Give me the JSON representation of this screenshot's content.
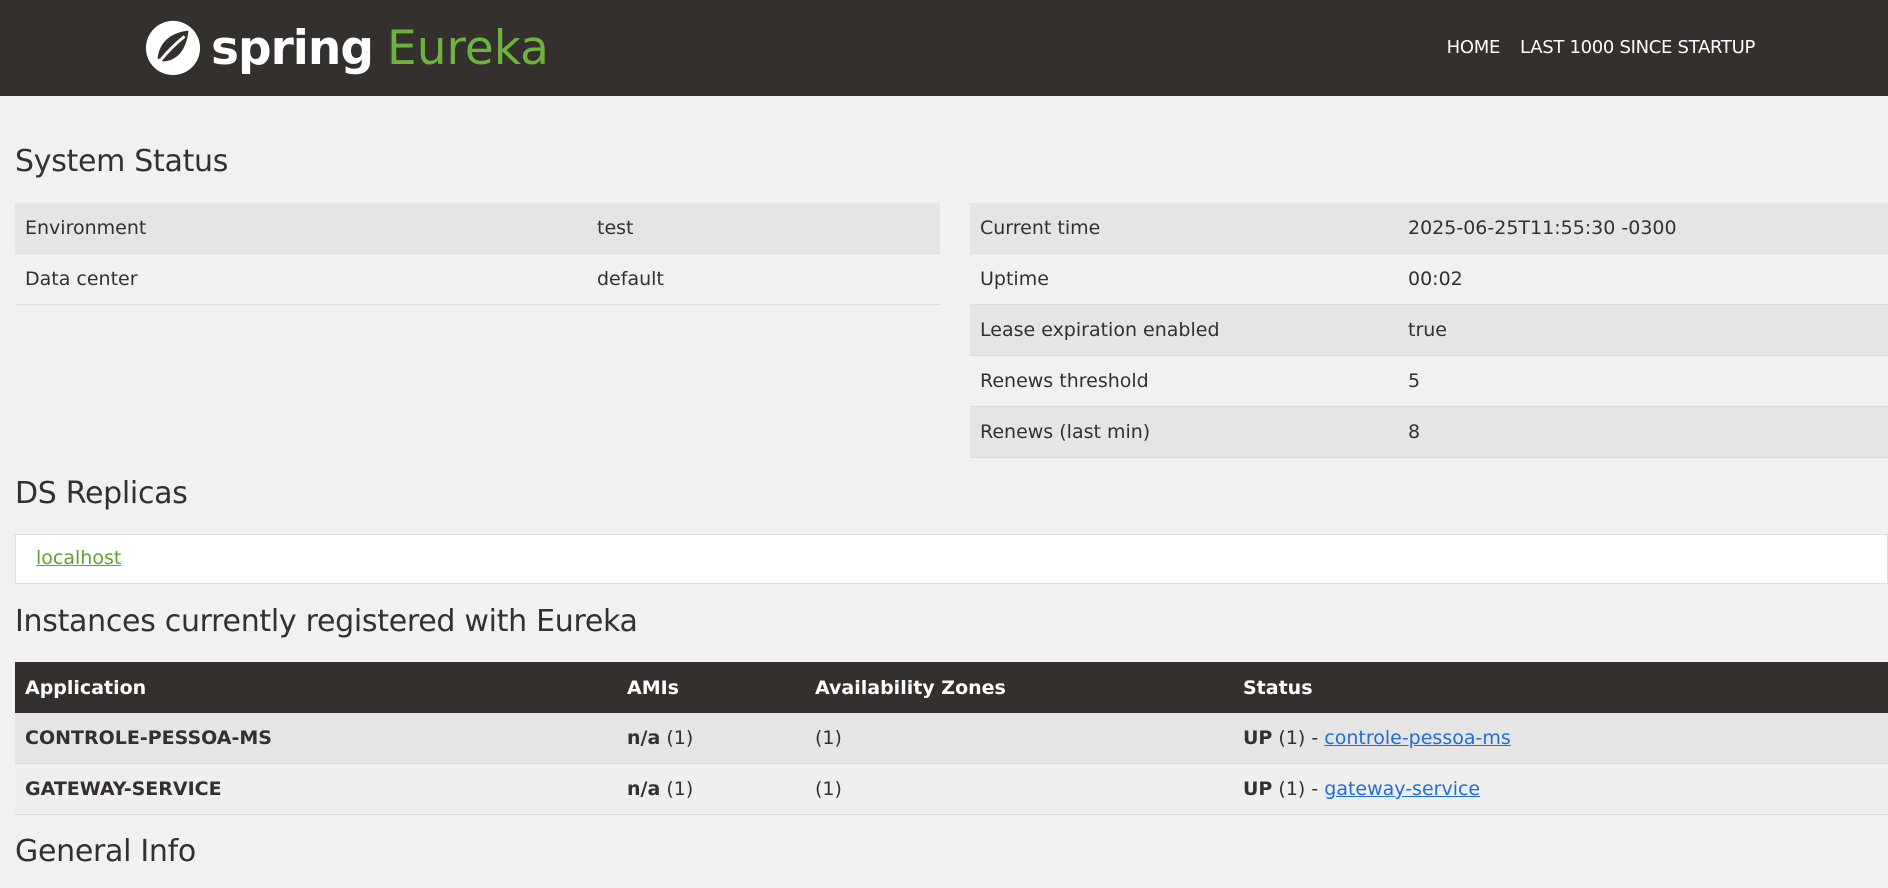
{
  "brand": {
    "spring": "spring",
    "eureka": "Eureka"
  },
  "nav": {
    "home": "HOME",
    "last1000": "LAST 1000 SINCE STARTUP"
  },
  "system_status": {
    "title": "System Status",
    "left": [
      {
        "label": "Environment",
        "value": "test"
      },
      {
        "label": "Data center",
        "value": "default"
      }
    ],
    "right": [
      {
        "label": "Current time",
        "value": "2025-06-25T11:55:30 -0300"
      },
      {
        "label": "Uptime",
        "value": "00:02"
      },
      {
        "label": "Lease expiration enabled",
        "value": "true"
      },
      {
        "label": "Renews threshold",
        "value": "5"
      },
      {
        "label": "Renews (last min)",
        "value": "8"
      }
    ]
  },
  "ds_replicas": {
    "title": "DS Replicas",
    "link": "localhost"
  },
  "instances": {
    "title": "Instances currently registered with Eureka",
    "headers": [
      "Application",
      "AMIs",
      "Availability Zones",
      "Status"
    ],
    "rows": [
      {
        "app": "CONTROLE-PESSOA-MS",
        "ami_bold": "n/a",
        "ami_count": "(1)",
        "zones": "(1)",
        "status": "UP",
        "status_count": "(1) -",
        "instance": "controle-pessoa-ms"
      },
      {
        "app": "GATEWAY-SERVICE",
        "ami_bold": "n/a",
        "ami_count": "(1)",
        "zones": "(1)",
        "status": "UP",
        "status_count": "(1) -",
        "instance": "gateway-service"
      }
    ]
  },
  "general_info": {
    "title": "General Info"
  },
  "colors": {
    "navbar": "#34302d",
    "accent": "#6db33f",
    "link": "#1e6ed6"
  }
}
